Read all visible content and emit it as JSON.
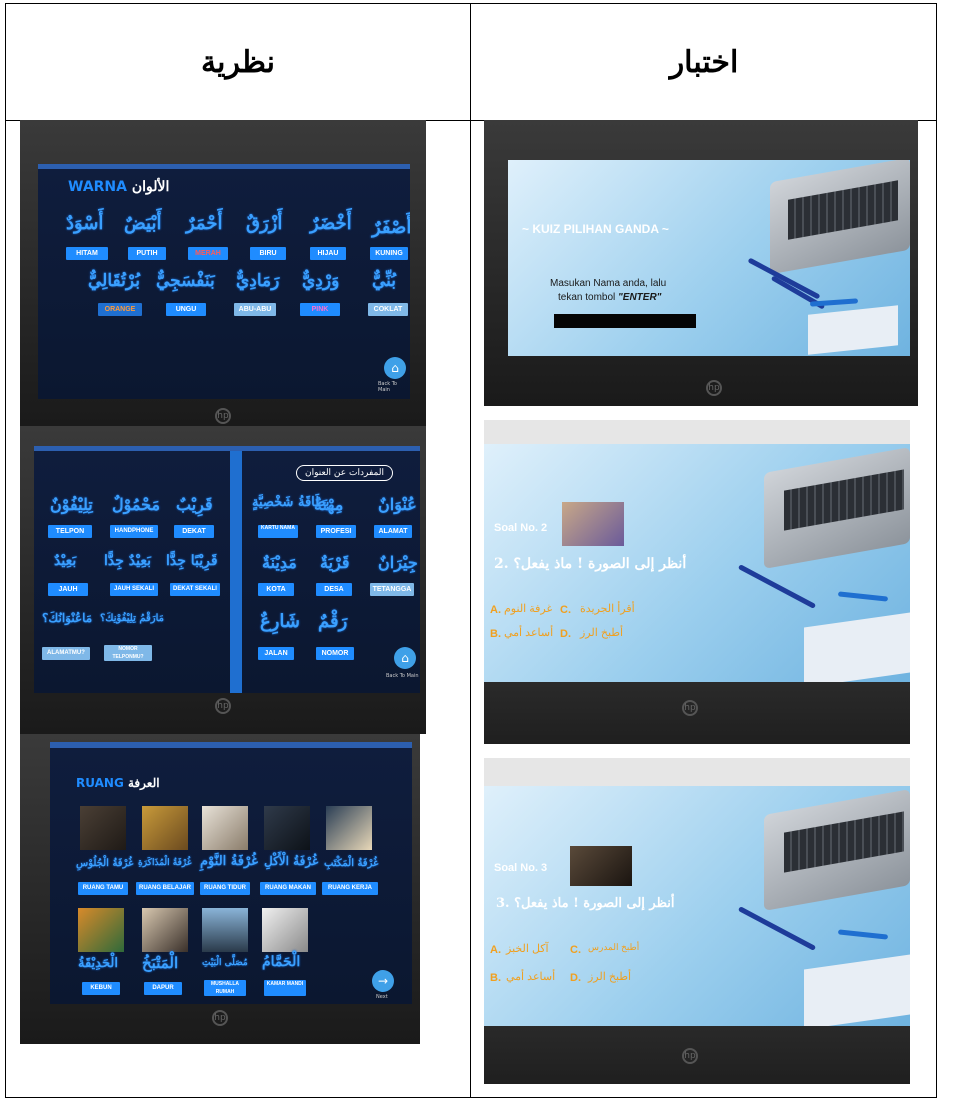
{
  "table": {
    "col_left_header": "نظرية",
    "col_right_header": "اختبار"
  },
  "photo1": {
    "title_latin": "WARNA",
    "title_arabic": "الألوان",
    "row1_arabic": [
      "أَصْفَرٌ",
      "أَخْضَرٌ",
      "أَزْرَقٌ",
      "أَحْمَرٌ",
      "أَبْيَضٌ",
      "أَسْوَدٌ"
    ],
    "row1_labels": [
      "KUNING",
      "HIJAU",
      "BIRU",
      "MERAH",
      "PUTIH",
      "HITAM"
    ],
    "row2_arabic": [
      "بُنِّيٌّ",
      "وَرْدِيٌّ",
      "رَمَادِيٌّ",
      "بَنَفْسَجِيٌّ",
      "بُرْتُقَالِيٌّ"
    ],
    "row2_labels": [
      "COKLAT",
      "PINK",
      "ABU-ABU",
      "UNGU",
      "ORANGE"
    ],
    "back_label": "Back To Main"
  },
  "photo2": {
    "heading_arabic": "المفردات عن العنوان",
    "right_row1_arabic": [
      "عُنْوَانٌ",
      "مِهْنَةٌ",
      "بِطَاقَةُ شَخْصِيَّةٍ"
    ],
    "right_row1_labels": [
      "ALAMAT",
      "PROFESI",
      "KARTU NAMA"
    ],
    "right_row2_arabic": [
      "جِيْرَانٌ",
      "قَرْيَةٌ",
      "مَدِيْنَةٌ"
    ],
    "right_row2_labels": [
      "TETANGGA",
      "DESA",
      "KOTA"
    ],
    "right_row3_arabic": [
      "رَقْمٌ",
      "شَارِعٌ"
    ],
    "right_row3_labels": [
      "NOMOR",
      "JALAN"
    ],
    "left_row1_arabic": [
      "قَرِيْبٌ",
      "مَحْمُوْلٌ",
      "تِلِيْفُوْنٌ"
    ],
    "left_row1_labels": [
      "DEKAT",
      "HANDPHONE",
      "TELPON"
    ],
    "left_row2_arabic": [
      "قَرِيْبًا جِدًّا",
      "بَعِيْدٌ جِدًّا",
      "بَعِيْدٌ"
    ],
    "left_row2_labels": [
      "DEKAT SEKALI",
      "JAUH SEKALI",
      "JAUH"
    ],
    "left_row3_arabic": [
      "مَارَقْمُ تِلِيْفُوْنِكَ؟",
      "مَاعُنْوَانُكَ؟"
    ],
    "left_row3_labels": [
      "NOMOR TELPONMU?",
      "ALAMATMU?"
    ],
    "back_label": "Back To Main"
  },
  "photo3": {
    "title_latin": "RUANG",
    "title_arabic": "العرفة",
    "row1_arabic": [
      "غُرْفَةُ الْجُلُوْسِ",
      "غُرْفَةُ الْمُذَاكَرَةِ",
      "غُرْفَةُ النَّوْمِ",
      "غُرْفَةُ الْأَكْلِ",
      "غُرْفَةُ الْمَكْتَبِ"
    ],
    "row1_labels": [
      "RUANG TAMU",
      "RUANG BELAJAR",
      "RUANG TIDUR",
      "RUANG MAKAN",
      "RUANG KERJA"
    ],
    "row2_arabic": [
      "الْحَدِيْقَةُ",
      "الْمَتْبَخُ",
      "مُصَلَّى الْبَيْتِ",
      "الْحَمَّامُ"
    ],
    "row2_labels": [
      "KEBUN",
      "DAPUR",
      "MUSHALLA RUMAH",
      "KAMAR MANDI"
    ],
    "next_label": "Next"
  },
  "photo4": {
    "title": "~ KUIZ PILIHAN GANDA ~",
    "instruction_line1": "Masukan Nama anda, lalu",
    "instruction_line2_prefix": "tekan tombol ",
    "instruction_line2_key": "\"ENTER\""
  },
  "photo5": {
    "soal": "Soal No. 2",
    "question": "أنظر إلى الصورة ! ماذ يفعل؟ .2",
    "option_a_letter": "A.",
    "option_a_text": "غرفة النوم",
    "option_c_letter": "C.",
    "option_c_text": "أقرأ الجريدة",
    "option_b_letter": "B.",
    "option_b_text": "أساعد أمي",
    "option_d_letter": "D.",
    "option_d_text": "أطبخ الرز"
  },
  "photo6": {
    "soal": "Soal No. 3",
    "question": "أنظر إلى الصورة ! ماذ يفعل؟ .3",
    "option_a_letter": "A.",
    "option_a_text": "آكل الخبز",
    "option_c_letter": "C.",
    "option_c_text": "أطبخ المدرس",
    "option_b_letter": "B.",
    "option_b_text": "أساعد أمي",
    "option_d_letter": "D.",
    "option_d_text": "أطبخ الرز"
  }
}
